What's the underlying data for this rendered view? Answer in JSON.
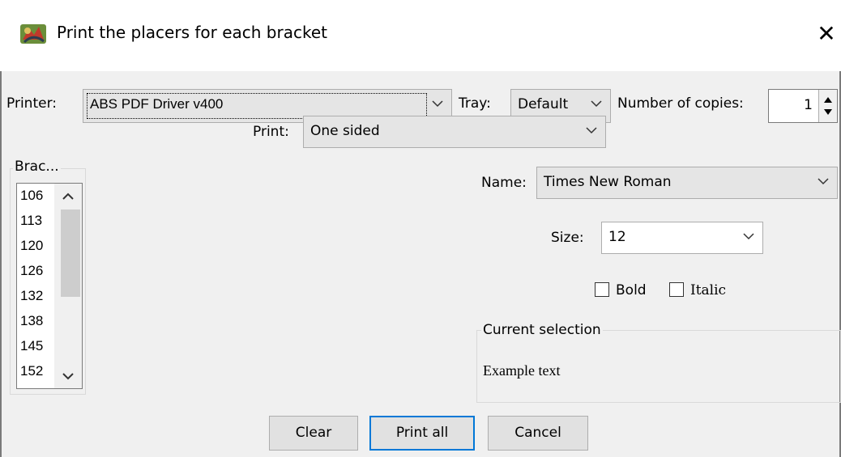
{
  "window": {
    "title": "Print the placers for each bracket",
    "close_symbol": "✕"
  },
  "printer": {
    "label": "Printer:",
    "value": "ABS PDF Driver v400"
  },
  "tray": {
    "label": "Tray:",
    "value": "Default"
  },
  "copies": {
    "label": "Number of copies:",
    "value": "1"
  },
  "print_mode": {
    "label": "Print:",
    "value": "One sided"
  },
  "brackets": {
    "title": "Brac...",
    "items": [
      "106",
      "113",
      "120",
      "126",
      "132",
      "138",
      "145",
      "152"
    ]
  },
  "font": {
    "name_label": "Name:",
    "name_value": "Times New Roman",
    "size_label": "Size:",
    "size_value": "12",
    "bold_label": "Bold",
    "italic_label": "Italic"
  },
  "selection": {
    "title": "Current selection",
    "example": "Example text"
  },
  "buttons": {
    "clear": "Clear",
    "print_all": "Print all",
    "cancel": "Cancel"
  },
  "colors": {
    "accent": "#0078d7",
    "window_bg": "#f0f0f0",
    "combo_bg": "#e5e5e5"
  }
}
